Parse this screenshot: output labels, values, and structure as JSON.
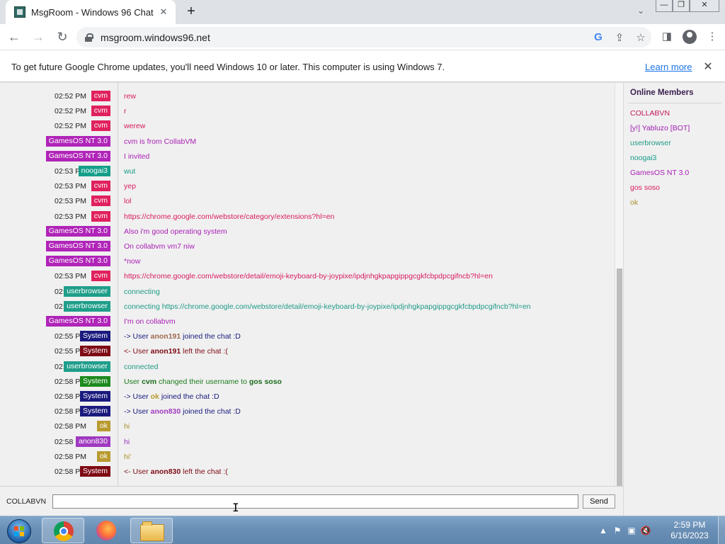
{
  "browser": {
    "tab_title": "MsgRoom - Windows 96 Chat",
    "tab_close": "✕",
    "new_tab": "+",
    "url": "msgroom.windows96.net",
    "infobar_message": "To get future Google Chrome updates, you'll need Windows 10 or later. This computer is using Windows 7.",
    "infobar_link": "Learn more"
  },
  "colors": {
    "cvm": "#e0215d",
    "gamesos": "#b024b8",
    "noogai3": "#139e8a",
    "userbrowser": "#1f9e8a",
    "system_join": "#1a1a7e",
    "system_leave": "#7e0a14",
    "system_rename": "#1d8a1d",
    "ok": "#b89a2e",
    "anon830": "#a03ac0"
  },
  "chat": {
    "messages": [
      {
        "time": "02:52 PM",
        "nick": "cvm",
        "nick_color": "#e0215d",
        "text": "rew",
        "text_color": "#d81b60"
      },
      {
        "time": "02:52 PM",
        "nick": "cvm",
        "nick_color": "#e0215d",
        "text": "r",
        "text_color": "#d81b60"
      },
      {
        "time": "02:52 PM",
        "nick": "cvm",
        "nick_color": "#e0215d",
        "text": "werew",
        "text_color": "#d81b60"
      },
      {
        "time": "02:52 PM",
        "nick": "GamesOS NT 3.0",
        "nick_color": "#b024b8",
        "text": "cvm is from CollabVM",
        "text_color": "#a91fb5"
      },
      {
        "time": "02:52 PM",
        "nick": "GamesOS NT 3.0",
        "nick_color": "#b024b8",
        "text": "I invited",
        "text_color": "#a91fb5"
      },
      {
        "time": "02:53 PM",
        "nick": "noogai3",
        "nick_color": "#139e8a",
        "text": "wut",
        "text_color": "#159a86"
      },
      {
        "time": "02:53 PM",
        "nick": "cvm",
        "nick_color": "#e0215d",
        "text": "yep",
        "text_color": "#d81b60"
      },
      {
        "time": "02:53 PM",
        "nick": "cvm",
        "nick_color": "#e0215d",
        "text": "lol",
        "text_color": "#d81b60"
      },
      {
        "time": "02:53 PM",
        "nick": "cvm",
        "nick_color": "#e0215d",
        "text": "https://chrome.google.com/webstore/category/extensions?hl=en",
        "text_color": "#d81b60"
      },
      {
        "time": "02:53 PM",
        "nick": "GamesOS NT 3.0",
        "nick_color": "#b024b8",
        "text": "Also i'm good operating system",
        "text_color": "#a91fb5"
      },
      {
        "time": "02:53 PM",
        "nick": "GamesOS NT 3.0",
        "nick_color": "#b024b8",
        "text": "On collabvm vm7 niw",
        "text_color": "#a91fb5"
      },
      {
        "time": "02:53 PM",
        "nick": "GamesOS NT 3.0",
        "nick_color": "#b024b8",
        "text": "*now",
        "text_color": "#a91fb5"
      },
      {
        "time": "02:53 PM",
        "nick": "cvm",
        "nick_color": "#e0215d",
        "text": "https://chrome.google.com/webstore/detail/emoji-keyboard-by-joypixe/ipdjnhgkpapgippgcgkfcbpdpcgifncb?hl=en",
        "text_color": "#d81b60"
      },
      {
        "time": "02:54 PM",
        "nick": "userbrowser",
        "nick_color": "#1f9e8a",
        "text": "connecting",
        "text_color": "#1f9a86"
      },
      {
        "time": "02:54 PM",
        "nick": "userbrowser",
        "nick_color": "#1f9e8a",
        "text": "connecting https://chrome.google.com/webstore/detail/emoji-keyboard-by-joypixe/ipdjnhgkpapgippgcgkfcbpdpcgifncb?hl=en",
        "text_color": "#1f9a86"
      },
      {
        "time": "02:55 PM",
        "nick": "GamesOS NT 3.0",
        "nick_color": "#b024b8",
        "text": "I'm on collabvm",
        "text_color": "#a91fb5"
      },
      {
        "time": "02:55 PM",
        "nick": "System",
        "nick_color": "#1a1a7e",
        "text_pre": "-> User ",
        "text_user": "anon191",
        "user_color": "#a06a50",
        "text_post": " joined the chat :D",
        "text_color": "#1a1a7e"
      },
      {
        "time": "02:55 PM",
        "nick": "System",
        "nick_color": "#7e0a14",
        "text_pre": "<- User ",
        "text_user": "anon191",
        "user_color": "#7e0a14",
        "text_post": " left the chat :(",
        "text_color": "#7e0a14"
      },
      {
        "time": "02:56 PM",
        "nick": "userbrowser",
        "nick_color": "#1f9e8a",
        "text": "connected",
        "text_color": "#1f9a86"
      },
      {
        "time": "02:58 PM",
        "nick": "System",
        "nick_color": "#1d8a1d",
        "text_pre": "User ",
        "text_user": "cvm",
        "user_color": "#1d6b1d",
        "text_post": " changed their username to ",
        "text_user2": "gos soso",
        "text_color": "#1d7a1d"
      },
      {
        "time": "02:58 PM",
        "nick": "System",
        "nick_color": "#1a1a7e",
        "text_pre": "-> User ",
        "text_user": "ok",
        "user_color": "#b89a2e",
        "text_post": " joined the chat :D",
        "text_color": "#1a1a7e"
      },
      {
        "time": "02:58 PM",
        "nick": "System",
        "nick_color": "#1a1a7e",
        "text_pre": "-> User ",
        "text_user": "anon830",
        "user_color": "#a03ac0",
        "text_post": " joined the chat :D",
        "text_color": "#1a1a7e"
      },
      {
        "time": "02:58 PM",
        "nick": "ok",
        "nick_color": "#b89a2e",
        "text": "hi",
        "text_color": "#a8902a"
      },
      {
        "time": "02:58 PM",
        "nick": "anon830",
        "nick_color": "#a03ac0",
        "text": "hi",
        "text_color": "#9a34b8"
      },
      {
        "time": "02:58 PM",
        "nick": "ok",
        "nick_color": "#b89a2e",
        "text": "hi'",
        "text_color": "#a8902a"
      },
      {
        "time": "02:58 PM",
        "nick": "System",
        "nick_color": "#7e0a14",
        "text_pre": "<- User ",
        "text_user": "anon830",
        "user_color": "#7e0a14",
        "text_post": " left the chat :(",
        "text_color": "#7e0a14"
      }
    ]
  },
  "members": {
    "heading": "Online Members",
    "list": [
      {
        "name": "COLLABVN",
        "color": "#c2185b"
      },
      {
        "name": "[y!] Yabluzo [BOT]",
        "color": "#a020b0"
      },
      {
        "name": "userbrowser",
        "color": "#1f9a86"
      },
      {
        "name": "noogai3",
        "color": "#159a86"
      },
      {
        "name": "GamesOS NT 3.0",
        "color": "#a91fb5"
      },
      {
        "name": "gos soso",
        "color": "#d81b60"
      },
      {
        "name": "ok",
        "color": "#a8902a"
      }
    ]
  },
  "input": {
    "username": "COLLABVN",
    "value": "",
    "send_label": "Send"
  },
  "taskbar": {
    "time": "2:59 PM",
    "date": "6/16/2023"
  }
}
